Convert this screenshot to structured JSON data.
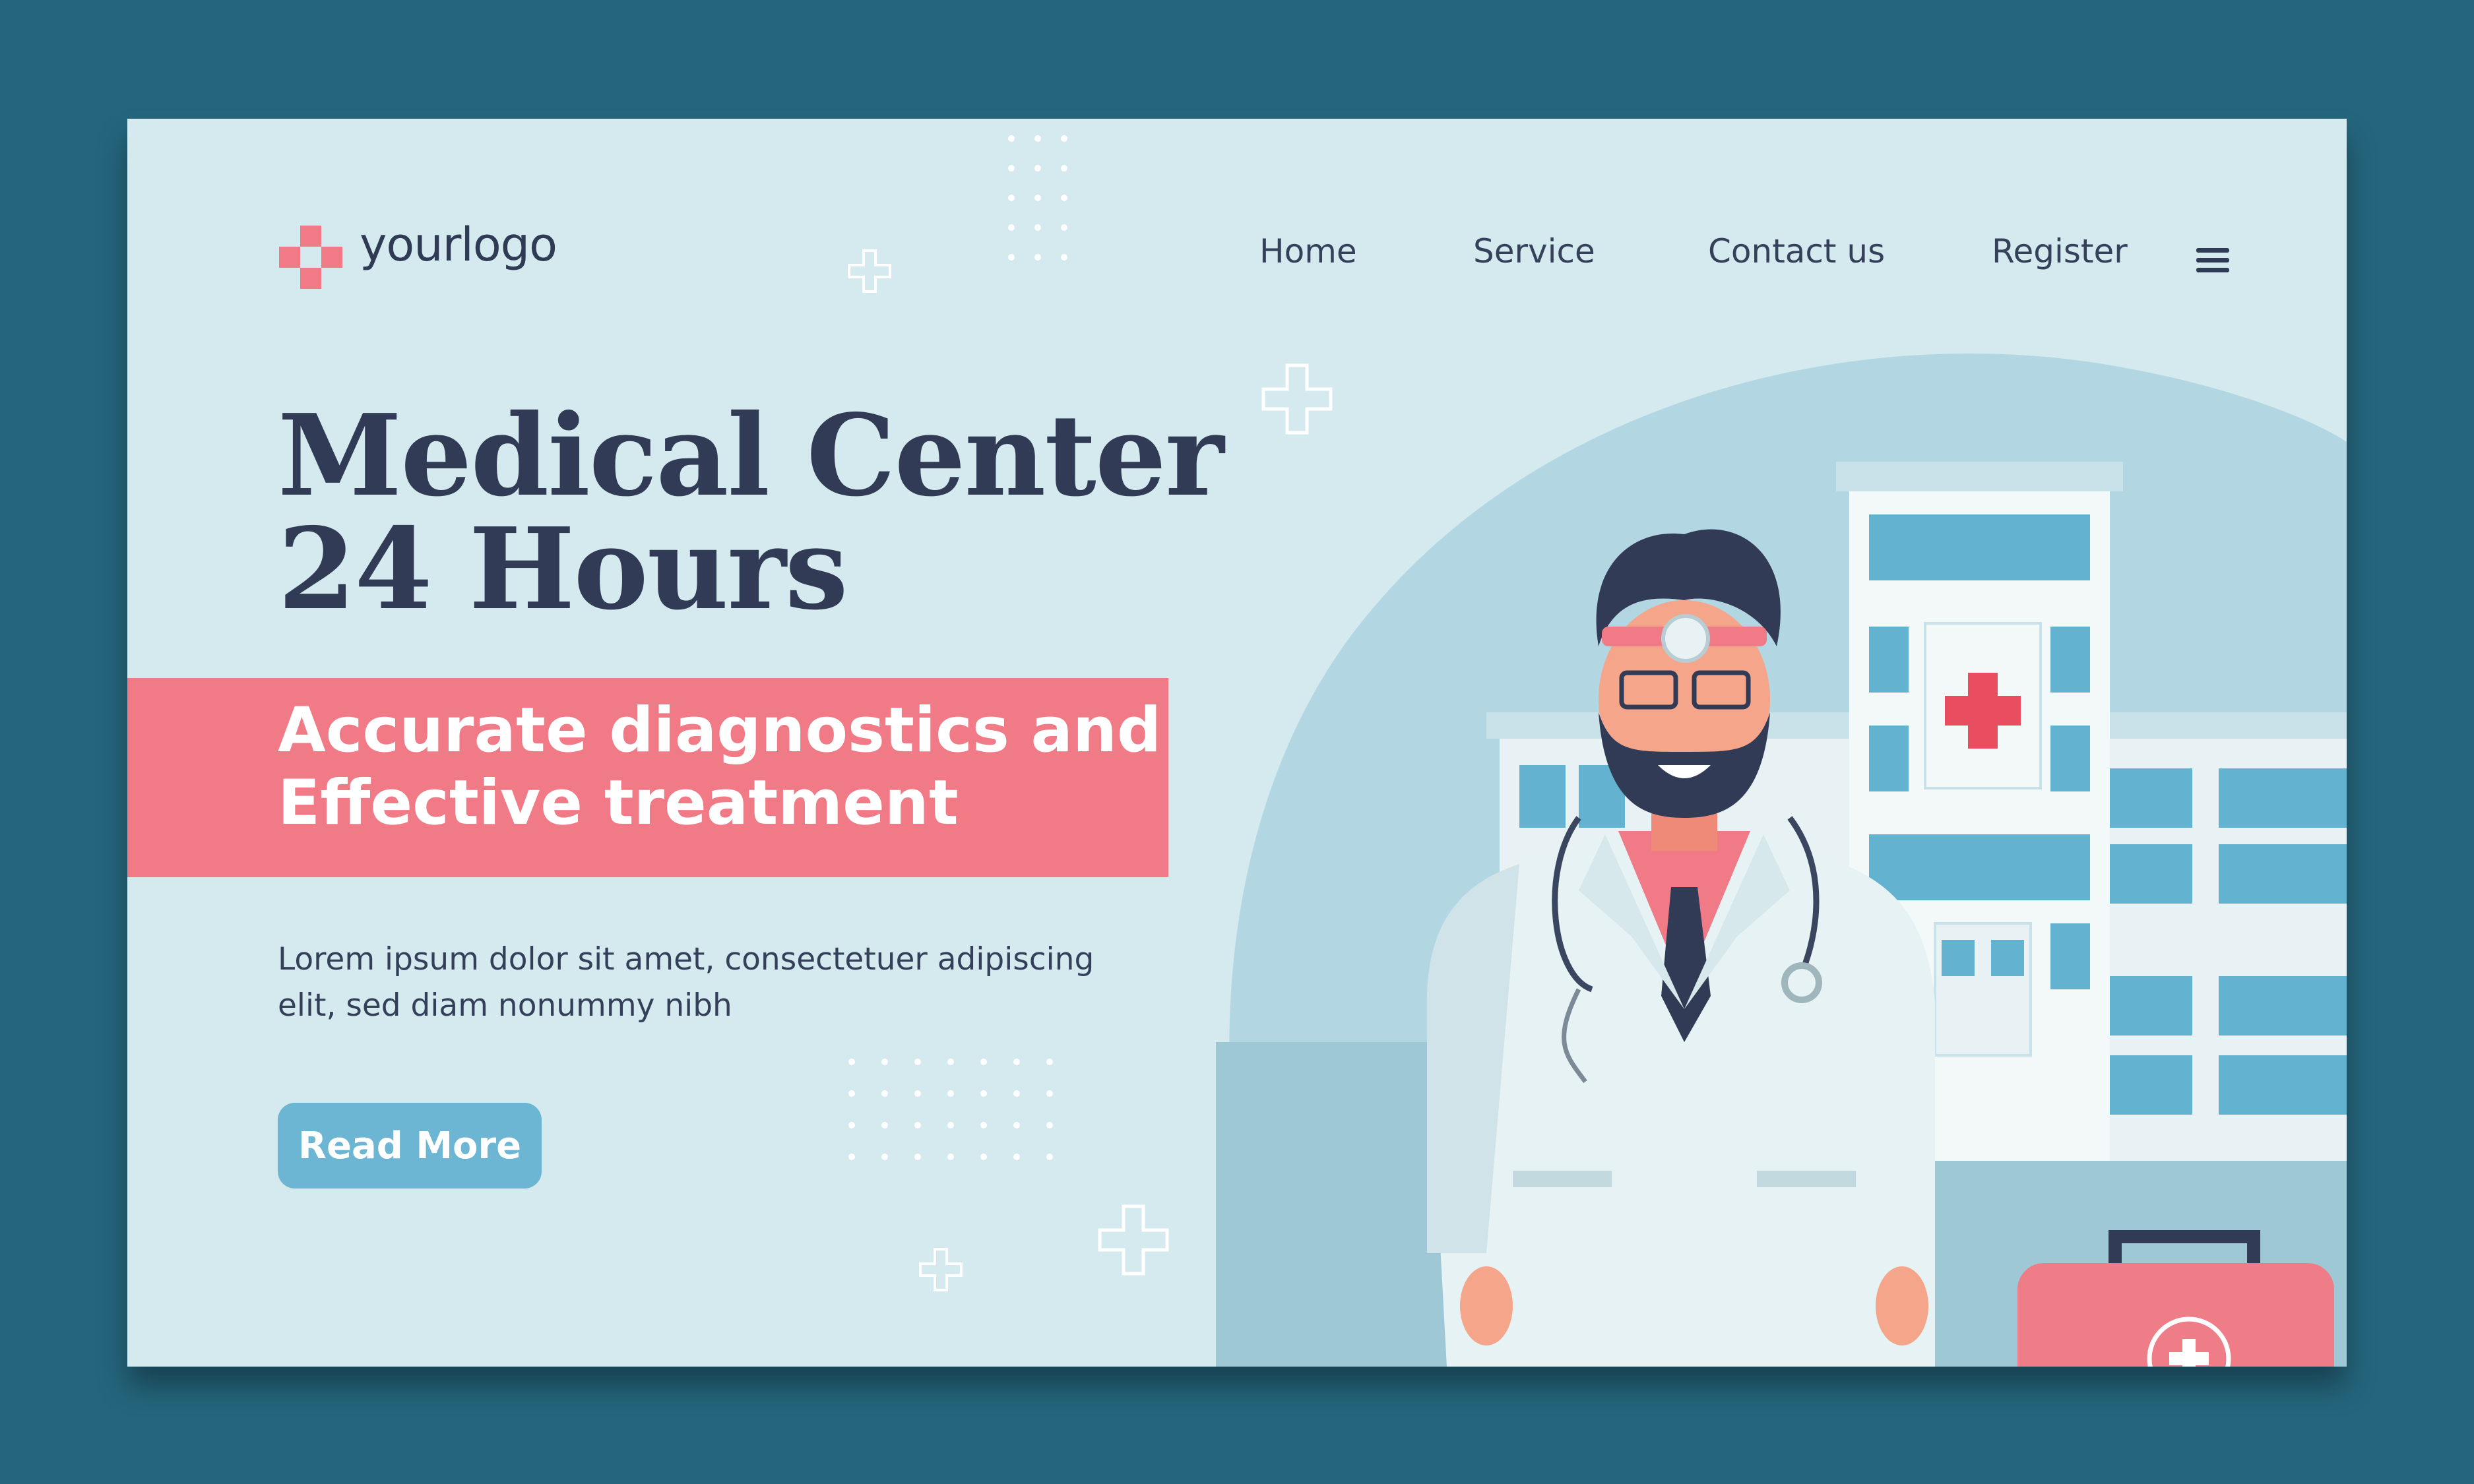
{
  "header": {
    "logo_text": "yourlogo",
    "nav": {
      "home": "Home",
      "service": "Service",
      "contact": "Contact us",
      "register": "Register"
    }
  },
  "hero": {
    "title_line1": "Medical Center",
    "title_line2": "24 Hours",
    "banner_line1": "Accurate diagnostics and",
    "banner_line2": "Effective treatment",
    "description_line1": "Lorem ipsum dolor sit amet, consectetuer adipiscing",
    "description_line2": "elit, sed diam nonummy nibh",
    "cta_label": "Read More"
  },
  "colors": {
    "page_bg": "#25667d",
    "card_bg": "#d4eaee",
    "accent_pink": "#f07a86",
    "button_blue": "#6cb6d4",
    "text_dark": "#323b55"
  },
  "icons": [
    "medical-cross-logo-icon",
    "hamburger-menu-icon",
    "plus-decor-icon",
    "first-aid-kit-icon"
  ]
}
